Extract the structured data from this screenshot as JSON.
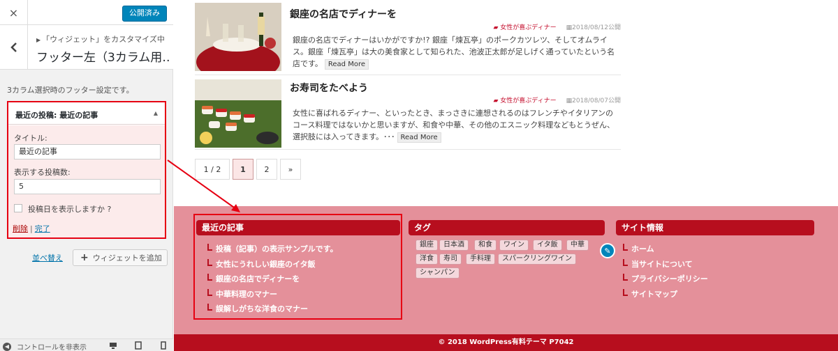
{
  "sidebar": {
    "close_label": "×",
    "publish_label": "公開済み",
    "breadcrumb": "「ウィジェット」をカスタマイズ中",
    "panel_title": "フッター左（3カラム用…",
    "description": "3カラム選択時のフッター設定です。",
    "widget": {
      "header": "最近の投稿: 最近の記事",
      "title_label": "タイトル:",
      "title_value": "最近の記事",
      "count_label": "表示する投稿数:",
      "count_value": "5",
      "show_date_label": "投稿日を表示しますか ?",
      "delete_label": "削除",
      "done_label": "完了"
    },
    "reorder_label": "並べ替え",
    "add_widget_label": "ウィジェットを追加",
    "collapse_label": "コントロールを非表示"
  },
  "preview": {
    "posts": [
      {
        "title": "銀座の名店でディナーを",
        "category": "女性が喜ぶディナー",
        "date": "2018/08/12公開",
        "excerpt": "銀座の名店でディナーはいかがですか!? 銀座「煉瓦亭」のポークカツレツ、そしてオムライス。銀座「煉瓦亭」は大の美食家として知られた、池波正太郎が足しげく通っていたという名店です。",
        "readmore": "Read More"
      },
      {
        "title": "お寿司をたべよう",
        "category": "女性が喜ぶディナー",
        "date": "2018/08/07公開",
        "excerpt": "女性に喜ばれるディナー、といったとき、まっさきに連想されるのはフレンチやイタリアンのコース料理ではないかと思いますが、和食や中華、その他のエスニック料理などもとうぜん、選択肢には入ってきます。･･･",
        "readmore": "Read More"
      }
    ],
    "pagination": [
      "1 / 2",
      "1",
      "2",
      "»"
    ],
    "footer": {
      "recent_title": "最近の記事",
      "recent_items": [
        "投稿（記事）の表示サンプルです。",
        "女性にうれしい銀座のイタ飯",
        "銀座の名店でディナーを",
        "中華料理のマナー",
        "誤解しがちな洋食のマナー"
      ],
      "tags_title": "タグ",
      "tags": [
        "銀座",
        "日本酒",
        "和食",
        "ワイン",
        "イタ飯",
        "中華",
        "洋食",
        "寿司",
        "手料理",
        "スパークリングワイン",
        "シャンパン"
      ],
      "site_title": "サイト情報",
      "site_items": [
        "ホーム",
        "当サイトについて",
        "プライバシーポリシー",
        "サイトマップ"
      ]
    },
    "copyright": "© 2018 WordPress有料テーマ P7042"
  },
  "colors": {
    "accent_red": "#b70e1e",
    "footer_bg": "#e4909a",
    "highlight": "#e60012",
    "wp_blue": "#0085ba"
  }
}
